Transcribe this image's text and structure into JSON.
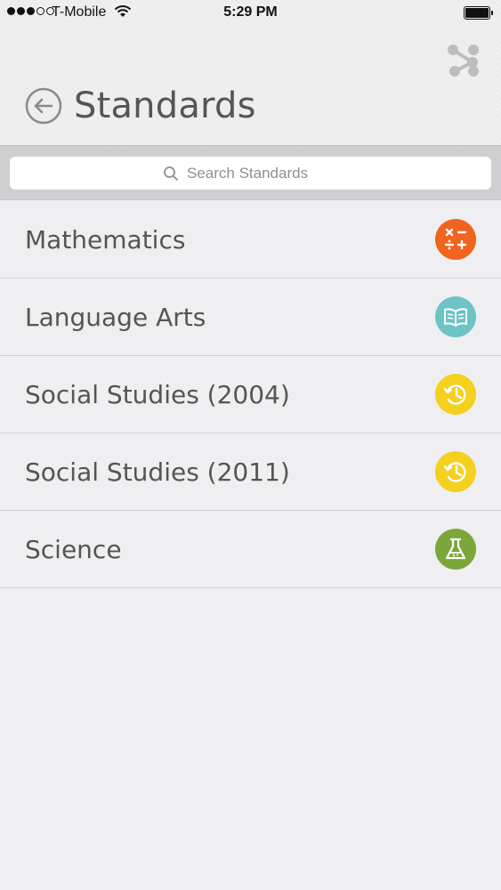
{
  "status_bar": {
    "carrier": "T-Mobile",
    "time": "5:29 PM"
  },
  "header": {
    "title": "Standards",
    "back_icon": "back-arrow-circle-icon",
    "share_icon": "share-nodes-icon"
  },
  "search": {
    "placeholder": "Search Standards"
  },
  "items": [
    {
      "label": "Mathematics",
      "icon": "math-operators-icon",
      "color": "#f0641e"
    },
    {
      "label": "Language Arts",
      "icon": "open-book-icon",
      "color": "#6ec3c6"
    },
    {
      "label": "Social Studies (2004)",
      "icon": "history-clock-icon",
      "color": "#f4d020"
    },
    {
      "label": "Social Studies (2011)",
      "icon": "history-clock-icon",
      "color": "#f4d020"
    },
    {
      "label": "Science",
      "icon": "flask-icon",
      "color": "#7aa63a"
    }
  ]
}
